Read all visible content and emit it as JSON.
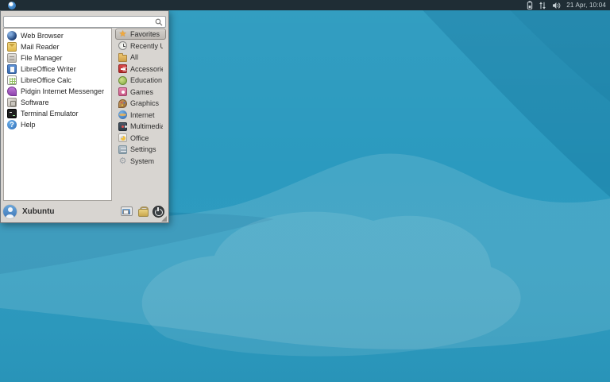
{
  "panel": {
    "whisker_button": {
      "icon": "xubuntu-logo-icon"
    },
    "tray": [
      {
        "icon": "battery-icon"
      },
      {
        "icon": "network-icon"
      },
      {
        "icon": "volume-icon"
      }
    ],
    "clock": "21 Apr, 10:04"
  },
  "menu": {
    "search": {
      "value": "",
      "placeholder": "",
      "icon": "search-icon"
    },
    "apps": [
      {
        "label": "Web Browser",
        "icon": "globe-icon"
      },
      {
        "label": "Mail Reader",
        "icon": "envelope-icon"
      },
      {
        "label": "File Manager",
        "icon": "file-cabinet-icon"
      },
      {
        "label": "LibreOffice Writer",
        "icon": "writer-document-icon"
      },
      {
        "label": "LibreOffice Calc",
        "icon": "calc-spreadsheet-icon"
      },
      {
        "label": "Pidgin Internet Messenger",
        "icon": "chat-bubble-icon"
      },
      {
        "label": "Software",
        "icon": "software-box-icon"
      },
      {
        "label": "Terminal Emulator",
        "icon": "terminal-icon"
      },
      {
        "label": "Help",
        "icon": "help-question-icon"
      }
    ],
    "categories": [
      {
        "label": "Favorites",
        "icon": "star-icon",
        "selected": true
      },
      {
        "label": "Recently Used",
        "icon": "clock-icon",
        "selected": false
      },
      {
        "label": "All",
        "icon": "folder-icon",
        "selected": false
      },
      {
        "label": "Accessories",
        "icon": "accessories-knife-icon",
        "selected": false
      },
      {
        "label": "Education",
        "icon": "education-icon",
        "selected": false
      },
      {
        "label": "Games",
        "icon": "gamepad-icon",
        "selected": false
      },
      {
        "label": "Graphics",
        "icon": "palette-icon",
        "selected": false
      },
      {
        "label": "Internet",
        "icon": "internet-globe-icon",
        "selected": false
      },
      {
        "label": "Multimedia",
        "icon": "multimedia-icon",
        "selected": false
      },
      {
        "label": "Office",
        "icon": "office-chart-icon",
        "selected": false
      },
      {
        "label": "Settings",
        "icon": "settings-sliders-icon",
        "selected": false
      },
      {
        "label": "System",
        "icon": "system-gear-icon",
        "selected": false
      }
    ],
    "footer": {
      "username": "Xubuntu",
      "avatar_icon": "user-avatar-icon",
      "buttons": [
        {
          "icon": "all-settings-window-icon"
        },
        {
          "icon": "lock-screen-icon"
        },
        {
          "icon": "log-out-power-icon"
        }
      ]
    }
  },
  "colors": {
    "wallpaper_base": "#2B9ABF",
    "wallpaper_light_wave": "#55B5D2",
    "wallpaper_dark_band": "#1E89B4",
    "panel_bg": "#1F2D35",
    "menu_bg": "#D8D5D1",
    "selection_bg": "#C2BFBB",
    "tray_icon_color": "#C7D1D6"
  }
}
